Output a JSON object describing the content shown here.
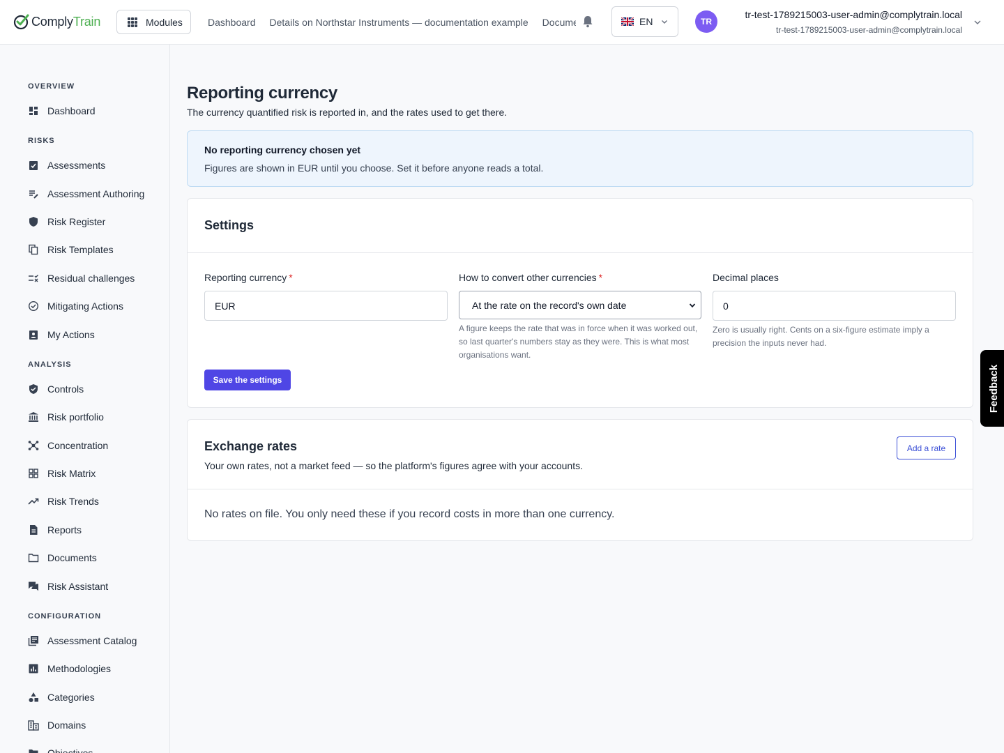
{
  "header": {
    "logo_part1": "Comply",
    "logo_part2": "Train",
    "modules_label": "Modules",
    "nav": [
      "Dashboard",
      "Details on Northstar Instruments — documentation example",
      "Documents"
    ],
    "language": "EN",
    "avatar_initials": "TR",
    "user_name": "tr-test-1789215003-user-admin@complytrain.local",
    "user_email": "tr-test-1789215003-user-admin@complytrain.local"
  },
  "sidebar": {
    "sections": {
      "overview": "OVERVIEW",
      "risks": "RISKS",
      "analysis": "ANALYSIS",
      "configuration": "CONFIGURATION"
    },
    "items": [
      {
        "label": "Dashboard",
        "icon": "dashboard-icon"
      },
      {
        "label": "Assessments",
        "icon": "clipboard-check-icon"
      },
      {
        "label": "Assessment Authoring",
        "icon": "edit-list-icon"
      },
      {
        "label": "Risk Register",
        "icon": "shield-icon"
      },
      {
        "label": "Risk Templates",
        "icon": "copy-icon"
      },
      {
        "label": "Residual challenges",
        "icon": "rule-icon"
      },
      {
        "label": "Mitigating Actions",
        "icon": "check-circle-icon"
      },
      {
        "label": "My Actions",
        "icon": "assignment-ind-icon"
      },
      {
        "label": "Controls",
        "icon": "verified-shield-icon"
      },
      {
        "label": "Risk portfolio",
        "icon": "bank-icon"
      },
      {
        "label": "Concentration",
        "icon": "hub-icon"
      },
      {
        "label": "Risk Matrix",
        "icon": "grid-icon"
      },
      {
        "label": "Risk Trends",
        "icon": "trending-up-icon"
      },
      {
        "label": "Reports",
        "icon": "report-icon"
      },
      {
        "label": "Documents",
        "icon": "folder-icon"
      },
      {
        "label": "Risk Assistant",
        "icon": "chat-icon"
      },
      {
        "label": "Assessment Catalog",
        "icon": "library-icon"
      },
      {
        "label": "Methodologies",
        "icon": "bar-chart-icon"
      },
      {
        "label": "Categories",
        "icon": "category-icon"
      },
      {
        "label": "Domains",
        "icon": "domain-icon"
      },
      {
        "label": "Objectives",
        "icon": "objective-icon"
      }
    ]
  },
  "page": {
    "title": "Reporting currency",
    "subtitle": "The currency quantified risk is reported in, and the rates used to get there."
  },
  "alert": {
    "title": "No reporting currency chosen yet",
    "body": "Figures are shown in EUR until you choose. Set it before anyone reads a total."
  },
  "settings": {
    "title": "Settings",
    "currency_label": "Reporting currency",
    "currency_value": "EUR",
    "convert_label": "How to convert other currencies",
    "convert_value": "At the rate on the record's own date",
    "convert_help": "A figure keeps the rate that was in force when it was worked out, so last quarter's numbers stay as they were. This is what most organisations want.",
    "decimals_label": "Decimal places",
    "decimals_value": "0",
    "decimals_help": "Zero is usually right. Cents on a six-figure estimate imply a precision the inputs never had.",
    "required_mark": "*",
    "save_label": "Save the settings"
  },
  "rates": {
    "title": "Exchange rates",
    "subtitle": "Your own rates, not a market feed — so the platform's figures agree with your accounts.",
    "add_label": "Add a rate",
    "empty": "No rates on file. You only need these if you record costs in more than one currency."
  },
  "feedback_label": "Feedback",
  "colors": {
    "accent": "#4f46e5",
    "brand_green": "#4caf50",
    "avatar": "#7c5cf2",
    "alert_bg": "#eef5fd"
  }
}
